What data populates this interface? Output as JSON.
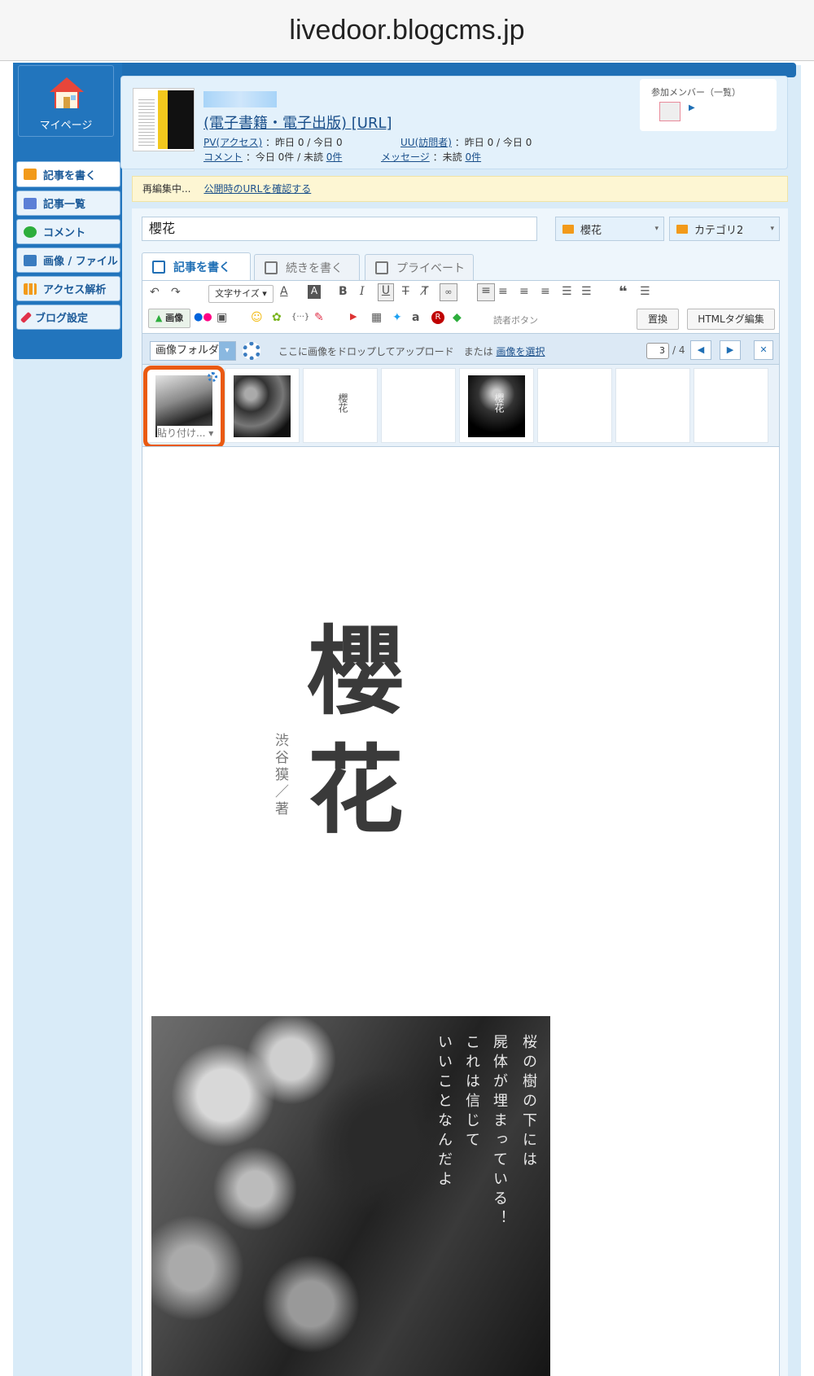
{
  "browser": {
    "url": "livedoor.blogcms.jp"
  },
  "sidebar": {
    "mypage_label": "マイページ",
    "items": [
      {
        "label": "記事を書く",
        "color": "#f29a1a"
      },
      {
        "label": "記事一覧",
        "color": "#5b7fd6"
      },
      {
        "label": "コメント",
        "color": "#2dae3c"
      },
      {
        "label": "画像 / ファイル",
        "color": "#3a7cc0"
      },
      {
        "label": "アクセス解析",
        "color": "#f29a1a"
      },
      {
        "label": "ブログ設定",
        "color": "#e0324a"
      }
    ]
  },
  "header": {
    "blog_title": "(電子書籍・電子出版) [URL]",
    "pv_label": "PV(アクセス)",
    "pv_value": "：昨日 0 / 今日 0",
    "uu_label": "UU(訪問者)",
    "uu_value": "：昨日 0 / 今日 0",
    "comment_label": "コメント",
    "comment_value": "：今日  0件 / 未読",
    "comment_unread": "0件",
    "message_label": "メッセージ",
    "message_value": "：未読",
    "message_unread": "0件",
    "members_title": "参加メンバー（一覧）"
  },
  "notice": {
    "text": "再編集中...",
    "link": "公開時のURLを確認する"
  },
  "editor": {
    "title_value": "櫻花",
    "category1": "櫻花",
    "category2": "カテゴリ2",
    "tabs": [
      "記事を書く",
      "続きを書く",
      "プライベート"
    ],
    "toolbar": {
      "font_size": "文字サイズ",
      "image_button": "画像",
      "reader_button": "読者ボタン",
      "replace_button": "置換",
      "html_button": "HTMLタグ編集"
    },
    "image_bar": {
      "folder": "画像フォルダ",
      "drop_text": "ここに画像をドロップしてアップロード　または",
      "select_link": "画像を選択",
      "page": "3",
      "total": "/ 4"
    },
    "thumbnails": {
      "paste_label": "貼り付け",
      "thumb_text": "櫻花"
    }
  },
  "article": {
    "title": "櫻花",
    "author": "渋谷獏／著",
    "poem_lines": [
      "桜の樹の下には",
      "屍体が埋まっている！",
      "これは信じて",
      "いいことなんだよ"
    ]
  }
}
